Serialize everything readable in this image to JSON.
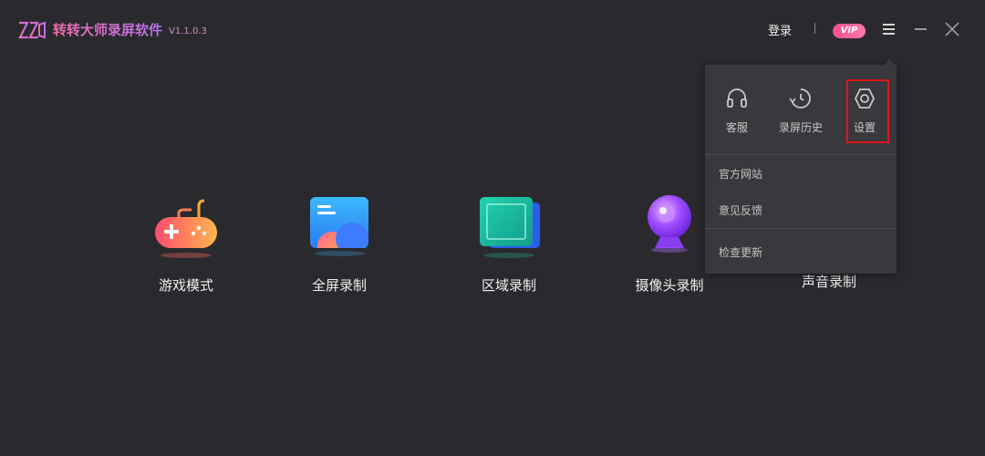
{
  "app": {
    "title": "转转大师录屏软件",
    "version": "V1.1.0.3"
  },
  "header": {
    "login_label": "登录",
    "vip_label": "VIP"
  },
  "modes": [
    {
      "label": "游戏模式",
      "icon": "gamepad-icon"
    },
    {
      "label": "全屏录制",
      "icon": "fullscreen-record-icon"
    },
    {
      "label": "区域录制",
      "icon": "area-record-icon"
    },
    {
      "label": "摄像头录制",
      "icon": "webcam-icon"
    },
    {
      "label": "声音录制",
      "icon": "audio-record-icon"
    }
  ],
  "dropdown": {
    "tools": [
      {
        "label": "客服",
        "icon": "headset-icon"
      },
      {
        "label": "录屏历史",
        "icon": "history-clock-icon"
      },
      {
        "label": "设置",
        "icon": "settings-icon",
        "highlighted": true
      }
    ],
    "items": [
      {
        "label": "官方网站"
      },
      {
        "label": "意见反馈"
      },
      {
        "label": "检查更新"
      }
    ]
  },
  "colors": {
    "background": "#2a2a2e",
    "dropdown_bg": "#39393d",
    "brand_gradient_start": "#f06cae",
    "brand_gradient_end": "#b471f0",
    "vip_pink": "#f4508f",
    "highlight_red": "#e01616"
  }
}
